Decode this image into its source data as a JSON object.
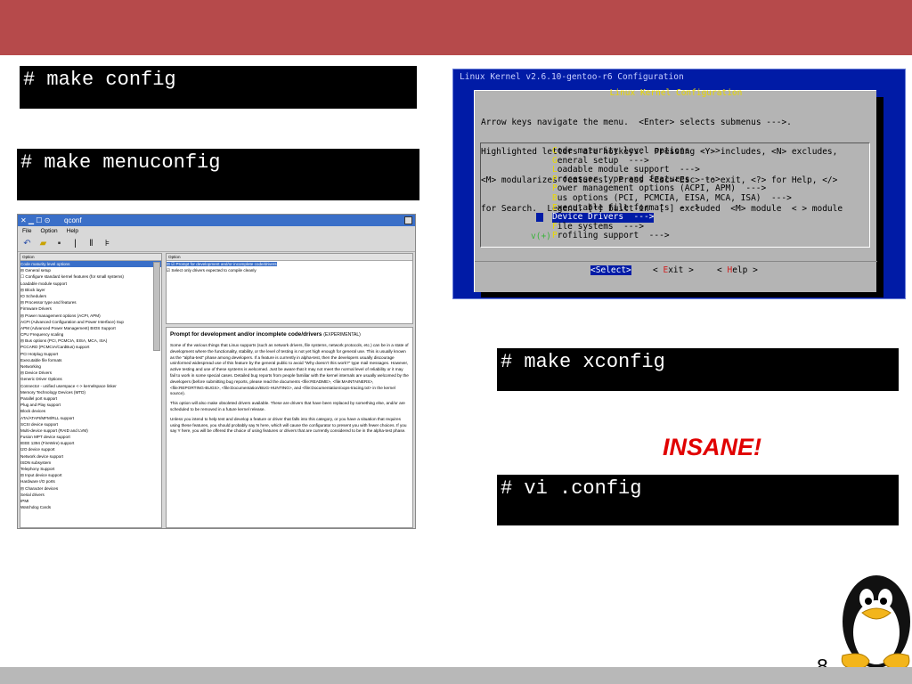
{
  "slide": {
    "page_number": "8",
    "annotation": "INSANE!"
  },
  "commands": {
    "make_config": "# make config",
    "make_menuconfig": "# make menuconfig",
    "make_xconfig": "# make xconfig",
    "vi_config": "# vi .config"
  },
  "menuconfig": {
    "window_title": "Linux Kernel v2.6.10-gentoo-r6 Configuration",
    "dialog_title": "Linux Kernel Configuration",
    "help_lines": [
      "Arrow keys navigate the menu.  <Enter> selects submenus --->.",
      "Highlighted letters are hotkeys.  Pressing <Y> includes, <N> excludes,",
      "<M> modularizes features.  Press <Esc><Esc> to exit, <?> for Help, </>",
      "for Search.  Legend: [*] built-in  [ ] excluded  <M> module  < > module"
    ],
    "items": [
      {
        "hotkey": "C",
        "rest": "ode maturity level options  --->"
      },
      {
        "hotkey": "G",
        "rest": "eneral setup  --->"
      },
      {
        "hotkey": "L",
        "rest": "oadable module support  --->"
      },
      {
        "hotkey": "P",
        "rest": "rocessor type and features  --->"
      },
      {
        "hotkey": "P",
        "rest": "ower management options (ACPI, APM)  --->"
      },
      {
        "hotkey": "B",
        "rest": "us options (PCI, PCMCIA, EISA, MCA, ISA)  --->"
      },
      {
        "hotkey": "E",
        "rest": "xecutable file formats  --->"
      },
      {
        "hotkey": "D",
        "rest": "evice Drivers  --->"
      },
      {
        "hotkey": "F",
        "rest": "ile systems  --->"
      },
      {
        "hotkey": "P",
        "rest": "rofiling support  --->"
      }
    ],
    "selected_index": 7,
    "list_marker": "v(+)",
    "buttons": {
      "select": "<Select>",
      "exit_pre": "< ",
      "exit_hot": "E",
      "exit_post": "xit >",
      "help_pre": "< ",
      "help_hot": "H",
      "help_post": "elp >"
    }
  },
  "xconf": {
    "title": "qconf",
    "title_buttons": "✕ ▁ ☐ ⊙",
    "menu": [
      "File",
      "Option",
      "Help"
    ],
    "left_header": "Option",
    "left_rows": [
      "Code maturity level options",
      "⊟ General setup",
      "   ☐ Configure standard kernel features (for small systems)",
      "Loadable module support",
      "⊟ Block layer",
      "      IO Schedulers",
      "⊟ Processor type and features",
      "      Firmware Drivers",
      "⊟ Power management options (ACPI, APM)",
      "      ACPI (Advanced Configuration and Power Interface) Sup",
      "      APM (Advanced Power Management) BIOS Support",
      "      CPU Frequency scaling",
      "⊟ Bus options (PCI, PCMCIA, EISA, MCA, ISA)",
      "      PCCARD (PCMCIA/CardBus) support",
      "      PCI Hotplug Support",
      "Executable file formats",
      "Networking",
      "⊟ Device Drivers",
      "      Generic Driver Options",
      "      Connector - unified userspace <-> kernelspace linker",
      "      Memory Technology Devices (MTD)",
      "      Parallel port support",
      "      Plug and Play support",
      "      Block devices",
      "      ATA/ATAPI/MFM/RLL support",
      "      SCSI device support",
      "      Multi-device support (RAID and LVM)",
      "      Fusion MPT device support",
      "      IEEE 1394 (FireWire) support",
      "      I2O device support",
      "      Network device support",
      "      ISDN subsystem",
      "      Telephony Support",
      "   ⊟ Input device support",
      "         Hardware I/O ports",
      "   ⊟ Character devices",
      "         Serial drivers",
      "         IPMI",
      "         Watchdog Cards"
    ],
    "left_selected": 0,
    "right_header": "Option",
    "right_rows": [
      "⊟ ☑ Prompt for development and/or incomplete code/drivers",
      "      ☑ Select only drivers expected to compile cleanly"
    ],
    "help_title": "Prompt for development and/or incomplete code/drivers",
    "help_tag": "(EXPERIMENTAL)",
    "help_paragraphs": [
      "Some of the various things that Linux supports (such as network drivers, file systems, network protocols, etc.) can be in a state of development where the functionality, stability, or the level of testing is not yet high enough for general use. This is usually known as the \"alpha-test\" phase among developers. If a feature is currently in alpha-test, then the developers usually discourage uninformed widespread use of this feature by the general public to avoid \"Why doesn't this work?\" type mail messages. However, active testing and use of these systems is welcomed. Just be aware that it may not meet the normal level of reliability or it may fail to work in some special cases. Detailed bug reports from people familiar with the kernel internals are usually welcomed by the developers (before submitting bug reports, please read the documents <file:README>, <file:MAINTAINERS>, <file:REPORTING-BUGS>, <file:Documentation/BUG-HUNTING>, and <file:Documentation/oops-tracing.txt> in the kernel source).",
      "This option will also make obsoleted drivers available. These are drivers that have been replaced by something else, and/or are scheduled to be removed in a future kernel release.",
      "Unless you intend to help test and develop a feature or driver that falls into this category, or you have a situation that requires using these features, you should probably say N here, which will cause the configurator to present you with fewer choices. If you say Y here, you will be offered the choice of using features or drivers that are currently considered to be in the alpha-test phase."
    ]
  }
}
